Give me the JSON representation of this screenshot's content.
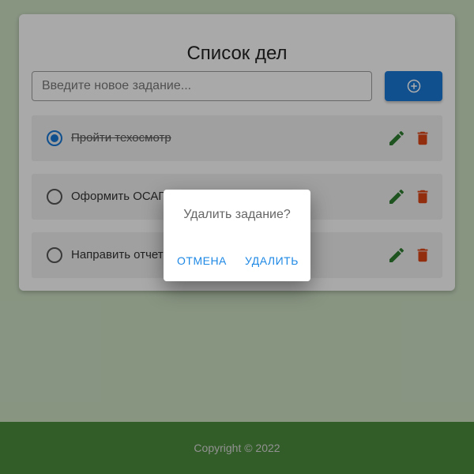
{
  "title": "Список дел",
  "new_task": {
    "placeholder": "Введите новое задание...",
    "value": ""
  },
  "add_button": {
    "icon": "plus-circle-icon"
  },
  "tasks": [
    {
      "text": "Пройти техосмотр",
      "completed": true
    },
    {
      "text": "Оформить ОСАГО",
      "completed": false
    },
    {
      "text": "Направить отчет руководителю",
      "completed": false
    }
  ],
  "dialog": {
    "title": "Удалить задание?",
    "cancel_label": "Отмена",
    "confirm_label": "Удалить"
  },
  "footer": {
    "copyright": "Copyright © 2022"
  },
  "colors": {
    "primary": "#1976d2",
    "edit": "#2e7d32",
    "delete": "#d84315",
    "footer": "#4a8a3c"
  }
}
